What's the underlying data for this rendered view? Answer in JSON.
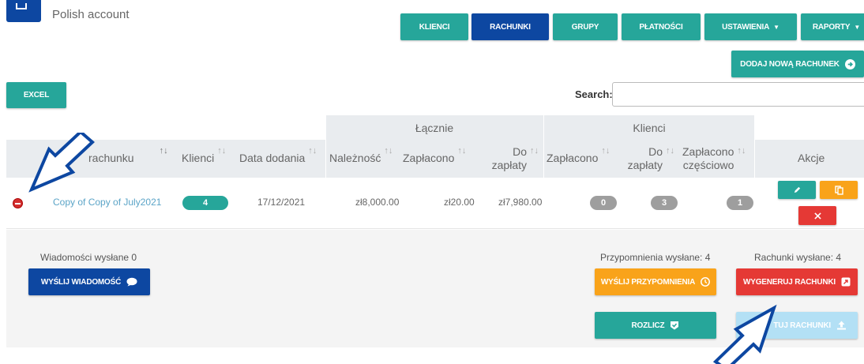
{
  "header": {
    "title": "Polish account"
  },
  "nav": {
    "klienci": "KLIENCI",
    "rachunki": "RACHUNKI",
    "grupy": "GRUPY",
    "platnosci": "PŁATNOŚCI",
    "ustawienia": "USTAWIENIA",
    "raporty": "RAPORTY"
  },
  "actions": {
    "add_invoice": "DODAJ NOWĄ RACHUNEK",
    "excel": "EXCEL"
  },
  "search": {
    "label": "Search:",
    "value": ""
  },
  "table": {
    "group_totals": "Łącznie",
    "group_clients": "Klienci",
    "columns": {
      "name": "rachunku",
      "clients": "Klienci",
      "date_added": "Data dodania",
      "due": "Należność",
      "paid": "Zapłacono",
      "to_pay_1": "Do",
      "to_pay_2": "zapłaty",
      "clients_paid": "Zapłacono",
      "clients_to_pay_1": "Do",
      "clients_to_pay_2": "zapłaty",
      "partial_1": "Zapłacono",
      "partial_2": "częściowo",
      "actions": "Akcje"
    },
    "row": {
      "name": "Copy of Copy of July2021",
      "clients": "4",
      "date_added": "17/12/2021",
      "due": "zł8,000.00",
      "paid": "zł20.00",
      "to_pay": "zł7,980.00",
      "clients_paid": "0",
      "clients_to_pay": "3",
      "clients_partial": "1"
    }
  },
  "details": {
    "messages_sent": "Wiadomości wysłane 0",
    "send_message": "WYŚLIJ WIADOMOŚĆ",
    "reminders_sent": "Przypomnienia wysłane: 4",
    "send_reminders": "WYŚLIJ PRZYPOMNIENIA",
    "invoices_sent": "Rachunki wysłane: 4",
    "generate_invoices": "WYGENERUJ RACHUNKI",
    "settle": "ROZLICZ",
    "send_invoices": "TUJ RACHUNKI"
  },
  "colors": {
    "teal": "#26a69a",
    "dark_blue": "#0d47a1",
    "orange": "#f9a31a",
    "red": "#e53935",
    "gray_pill": "#9e9e9e",
    "light_blue": "#b3e0f5"
  }
}
